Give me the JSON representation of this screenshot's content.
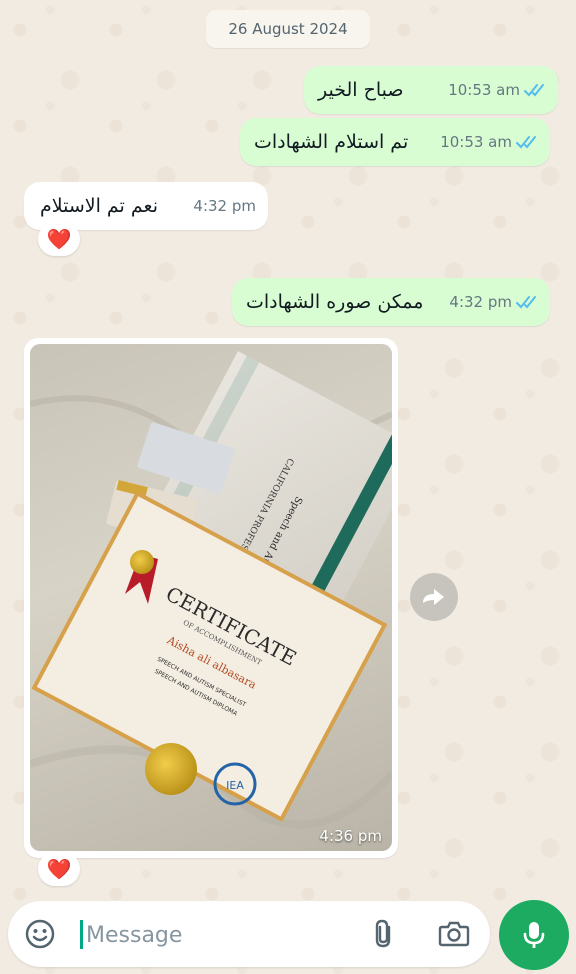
{
  "chat": {
    "date": "26 August 2024",
    "messages": [
      {
        "direction": "out",
        "text": "صباح الخير",
        "time": "10:53 am",
        "status": "read"
      },
      {
        "direction": "out",
        "text": "تم استلام الشهادات",
        "time": "10:53 am",
        "status": "read"
      },
      {
        "direction": "in",
        "text": "نعم تم الاستلام",
        "time": "4:32 pm",
        "reaction": "❤️"
      },
      {
        "direction": "out",
        "text": "ممكن صوره الشهادات",
        "time": "4:32 pm",
        "status": "read"
      },
      {
        "direction": "in",
        "type": "image",
        "time": "4:36 pm",
        "reaction": "❤️"
      }
    ]
  },
  "photo_content": {
    "certificate_title": "CERTIFICATE",
    "certificate_subtitle": "OF ACCOMPLISHMENT",
    "recipient": "Aisha ali albasara",
    "specialist": "SPEECH AND AUTISM SPECIALIST",
    "diploma_line": "SPEECH AND AUTISM DIPLOMA",
    "university": "CALIFORNIA PROFESSIONAL UNIVERSITY",
    "university_diploma": "Speech and Autism Diploma",
    "seal_text": "IEA"
  },
  "composer": {
    "placeholder": "Message",
    "value": ""
  },
  "icons": {
    "read_ticks": "double-check-icon",
    "forward": "forward-icon",
    "emoji": "emoji-icon",
    "attach": "paperclip-icon",
    "camera": "camera-icon",
    "mic": "microphone-icon"
  },
  "colors": {
    "outgoing_bubble": "#d9fdd3",
    "incoming_bubble": "#ffffff",
    "read_tick": "#53bdeb",
    "accent": "#1daa61",
    "background": "#f1ebe2"
  }
}
